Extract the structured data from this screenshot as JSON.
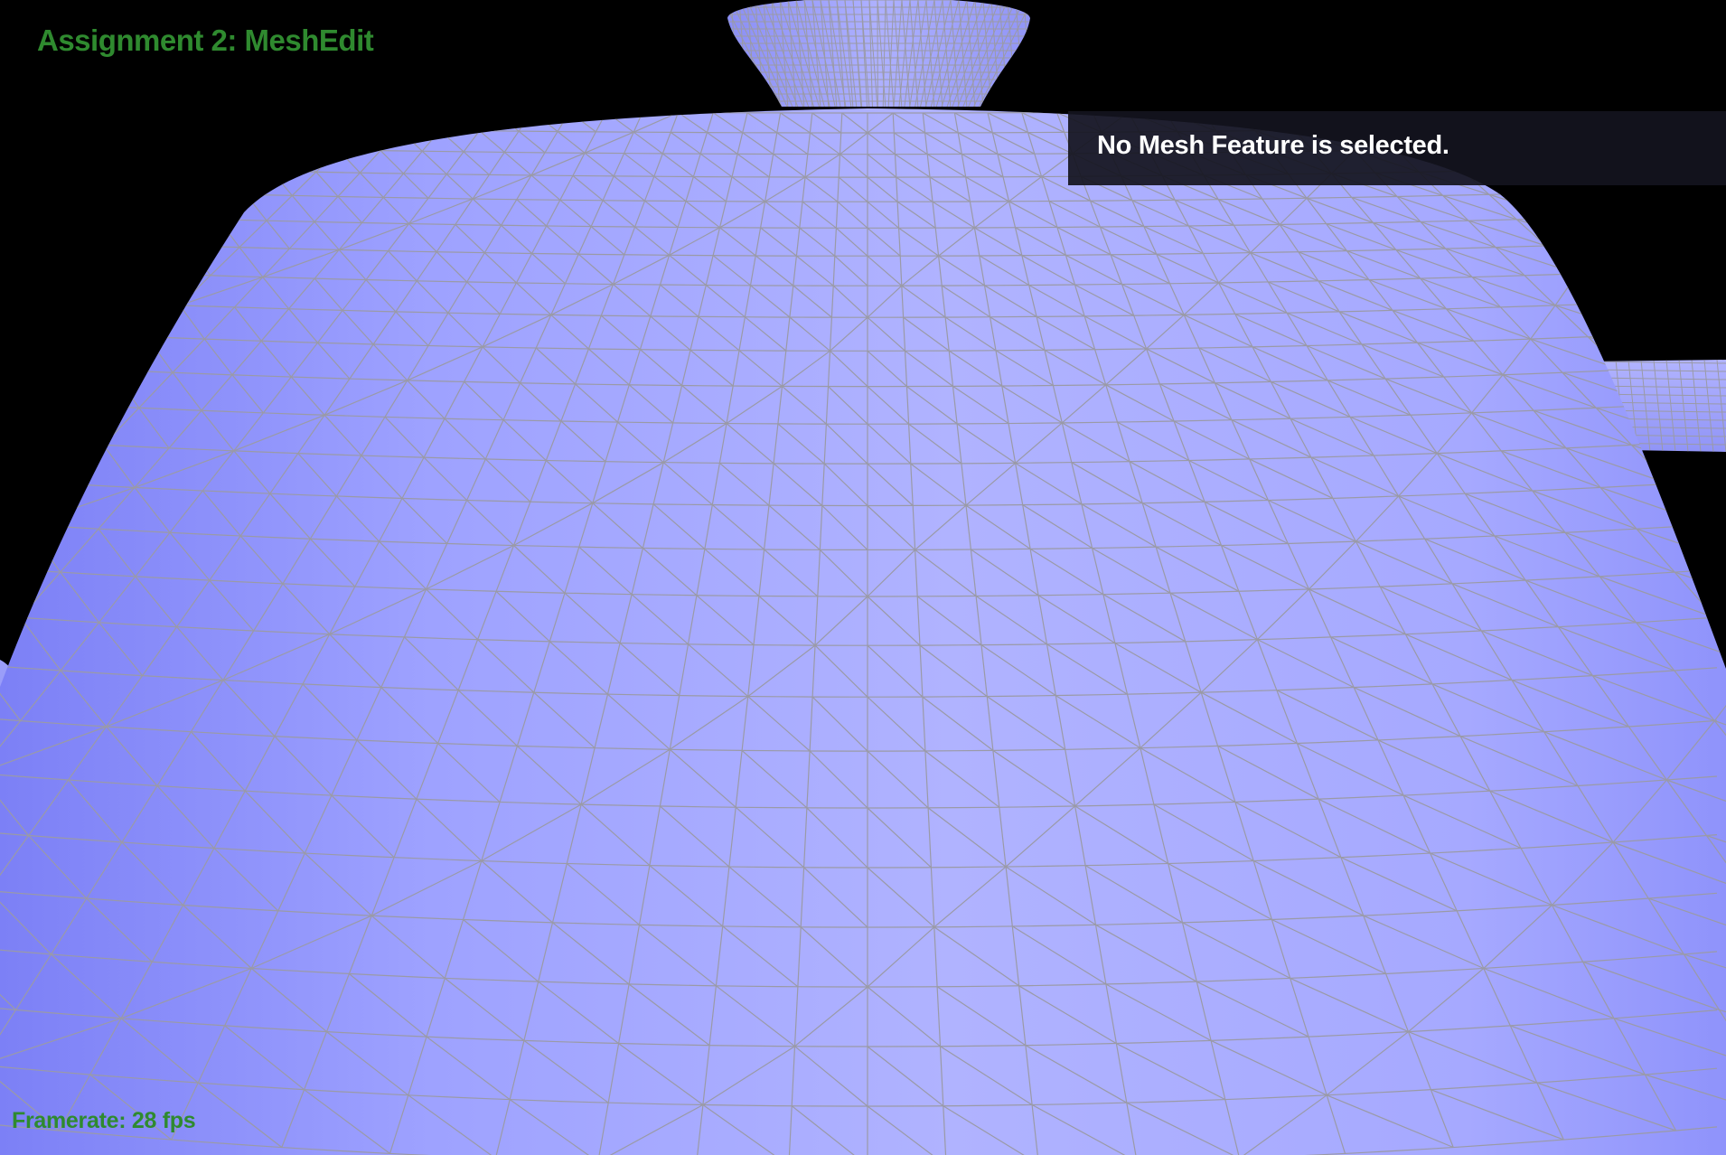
{
  "app": {
    "title": "Assignment 2: MeshEdit"
  },
  "selection": {
    "message": "No Mesh Feature is selected."
  },
  "status": {
    "framerate": "Framerate: 28 fps"
  },
  "scene": {
    "background_color": "#000000",
    "mesh_fill_light": "#b2b4ff",
    "mesh_fill_dark": "#8488fa",
    "wireframe_color": "#9a9aa6",
    "title_color": "#2f8a2f"
  }
}
